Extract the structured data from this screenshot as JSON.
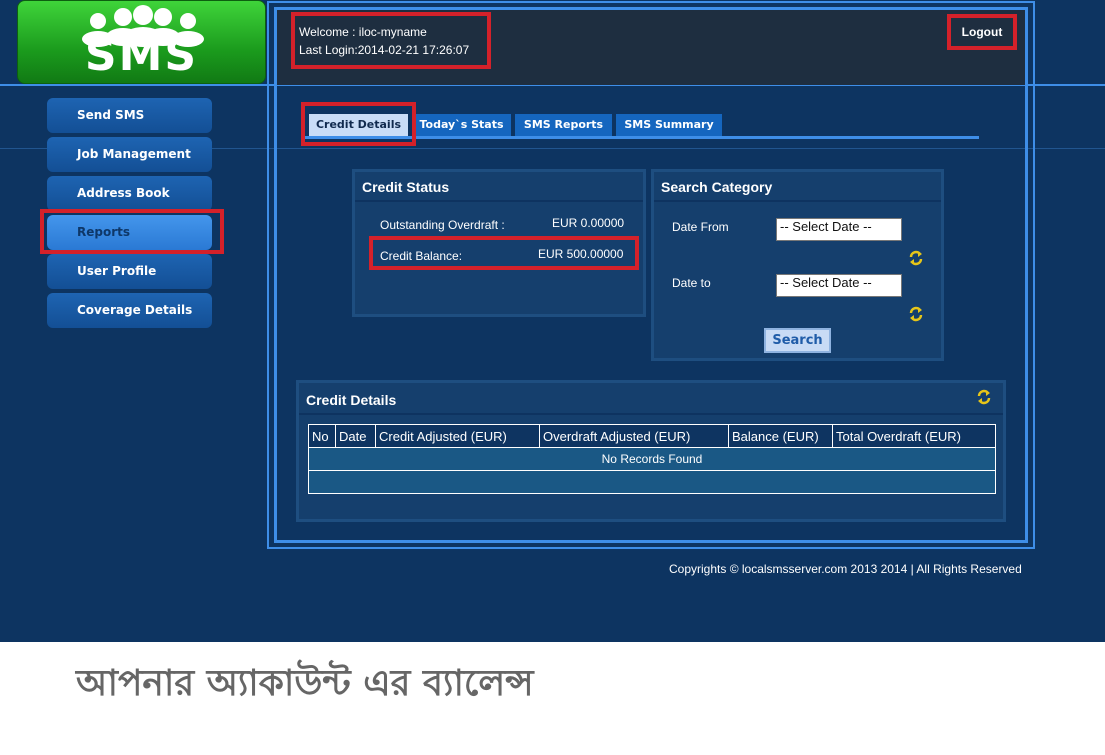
{
  "logo": {
    "text": "SMS"
  },
  "header": {
    "welcome": "Welcome : iloc-myname",
    "last_login": "Last Login:2014-02-21 17:26:07",
    "logout_label": "Logout"
  },
  "sidebar": {
    "items": [
      {
        "label": "Send SMS"
      },
      {
        "label": "Job Management"
      },
      {
        "label": "Address Book"
      },
      {
        "label": "Reports",
        "active": true
      },
      {
        "label": "User Profile"
      },
      {
        "label": "Coverage Details"
      }
    ]
  },
  "tabs": [
    {
      "label": "Credit Details",
      "active": true
    },
    {
      "label": "Today`s Stats"
    },
    {
      "label": "SMS Reports"
    },
    {
      "label": "SMS Summary"
    }
  ],
  "credit_status": {
    "title": "Credit Status",
    "overdraft_label": "Outstanding Overdraft :",
    "overdraft_value": "EUR 0.00000",
    "balance_label": "Credit Balance:",
    "balance_value": "EUR 500.00000"
  },
  "search_category": {
    "title": "Search Category",
    "date_from_label": "Date From",
    "date_from_value": "-- Select Date --",
    "date_to_label": "Date to",
    "date_to_value": "-- Select Date --",
    "search_label": "Search"
  },
  "credit_details": {
    "title": "Credit Details",
    "columns": [
      "No",
      "Date",
      "Credit Adjusted (EUR)",
      "Overdraft Adjusted (EUR)",
      "Balance (EUR)",
      "Total Overdraft (EUR)"
    ],
    "empty_message": "No Records Found"
  },
  "footer": {
    "copyright": "Copyrights © localsmsserver.com 2013 2014 | All Rights Reserved"
  },
  "caption": "আপনার অ্যাকাউন্ট এর ব্যালেন্স",
  "colors": {
    "background": "#0d3461",
    "accent_line": "#3e8ee8",
    "highlight_red": "#d4212a",
    "logo_green": "#1b9b1d"
  }
}
